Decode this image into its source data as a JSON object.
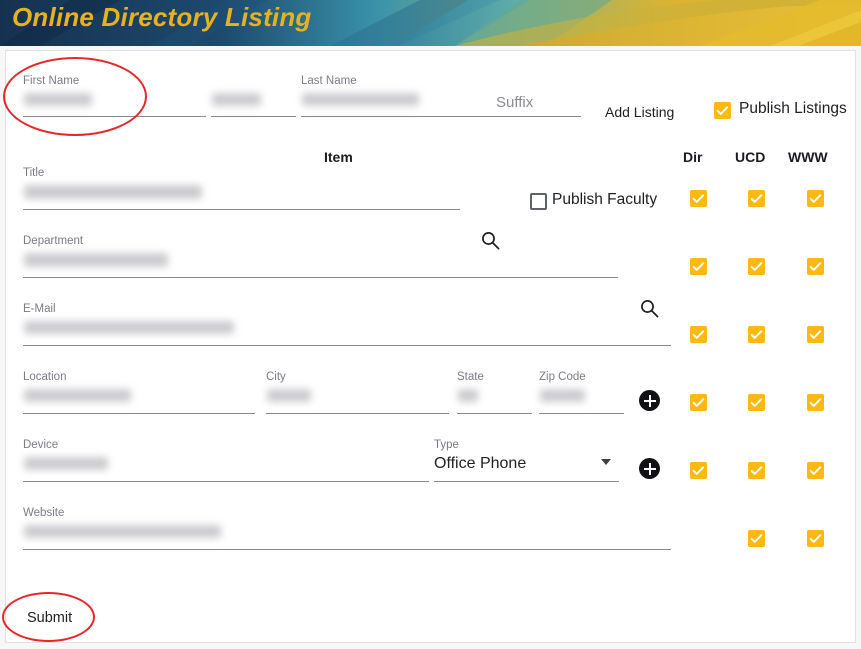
{
  "banner": {
    "title": "Online Directory Listing",
    "colors": {
      "navy": "#1b3a5c",
      "teal": "#3f9fb3",
      "gold": "#e0b126",
      "title_color": "#e8b11f"
    }
  },
  "theme": {
    "checkbox_checked": "#fcb813",
    "annotation": "#e8262a",
    "card_bg": "#ffffff",
    "page_bg": "#f7f7f7"
  },
  "name_row": {
    "first_name": {
      "label": "First Name",
      "value": "",
      "redacted": true
    },
    "middle_name": {
      "label": "",
      "value": "",
      "redacted": true
    },
    "last_name": {
      "label": "Last Name",
      "value": "",
      "redacted": true
    },
    "suffix": {
      "label": "",
      "placeholder": "Suffix",
      "value": ""
    },
    "add_listing_label": "Add Listing",
    "publish_listings": {
      "label": "Publish Listings",
      "checked": true
    }
  },
  "table_headers": {
    "item": "Item",
    "dir": "Dir",
    "ucd": "UCD",
    "www": "WWW"
  },
  "rows": {
    "title": {
      "label": "Title",
      "value": "",
      "redacted": true,
      "search_icon": "search-icon",
      "publish_faculty": {
        "label": "Publish Faculty",
        "checked": false
      },
      "dir": true,
      "ucd": true,
      "www": true
    },
    "department": {
      "label": "Department",
      "value": "",
      "redacted": true,
      "search_icon": "search-icon",
      "dir": true,
      "ucd": true,
      "www": true
    },
    "email": {
      "label": "E-Mail",
      "value": "",
      "redacted": true,
      "dir": true,
      "ucd": true,
      "www": true
    },
    "address": {
      "location": {
        "label": "Location",
        "value": "",
        "redacted": true
      },
      "city": {
        "label": "City",
        "value": "",
        "redacted": true
      },
      "state": {
        "label": "State",
        "value": "",
        "redacted": true
      },
      "zip": {
        "label": "Zip Code",
        "value": "",
        "redacted": true
      },
      "add_icon": "plus-icon",
      "dir": true,
      "ucd": true,
      "www": true
    },
    "device": {
      "device": {
        "label": "Device",
        "value": "",
        "redacted": true
      },
      "type": {
        "label": "Type",
        "value": "Office Phone",
        "dropdown_icon": "chevron-down-icon"
      },
      "add_icon": "plus-icon",
      "dir": true,
      "ucd": true,
      "www": true
    },
    "website": {
      "label": "Website",
      "value": "",
      "redacted": true,
      "dir": null,
      "ucd": true,
      "www": true
    }
  },
  "submit": {
    "label": "Submit"
  },
  "annotations": {
    "first_name_circle": "annotation-ellipse-first-name",
    "submit_circle": "annotation-ellipse-submit"
  }
}
